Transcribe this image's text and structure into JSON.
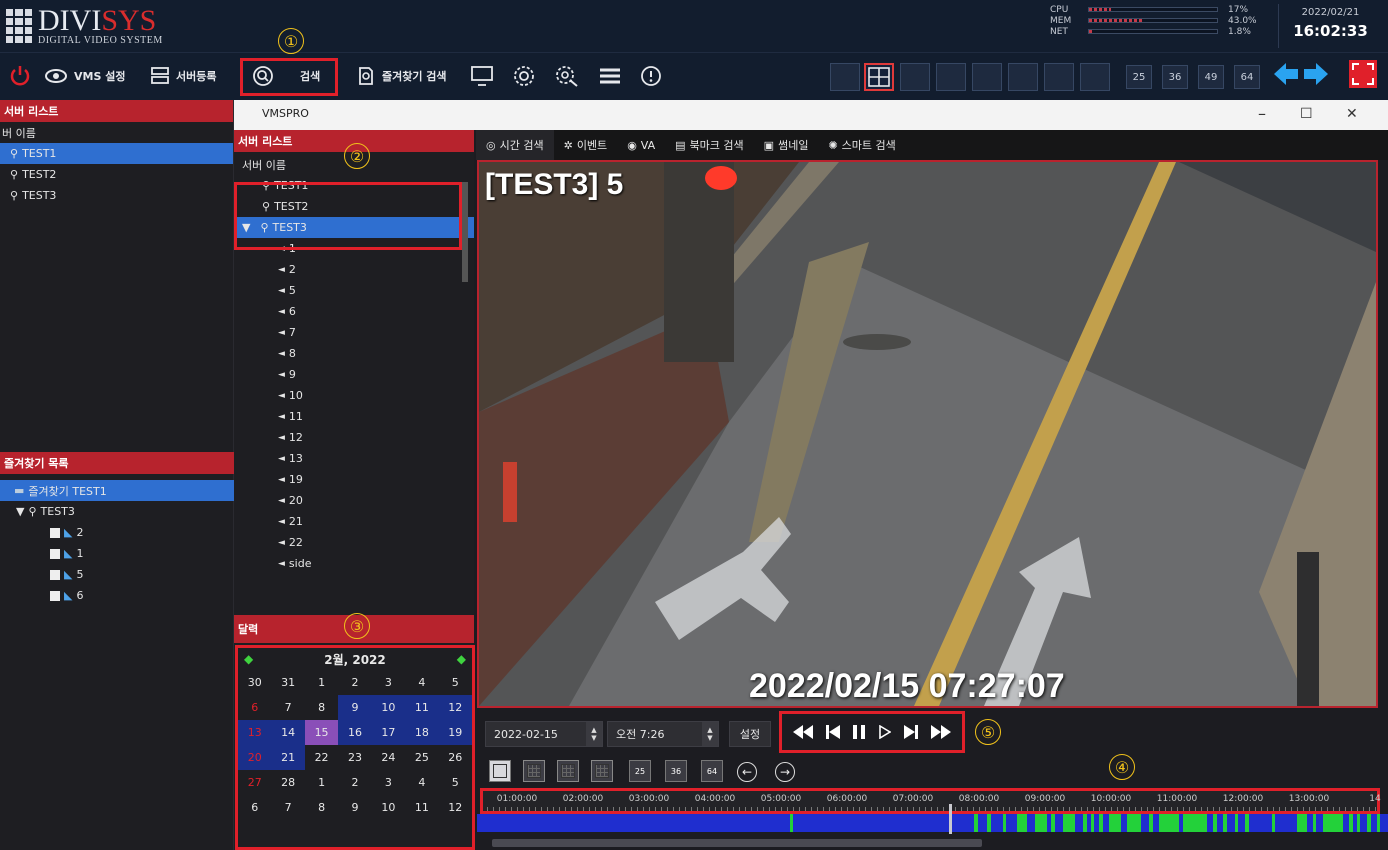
{
  "header": {
    "brand": "DIVISYS",
    "brand_sub": "DIGITAL VIDEO SYSTEM",
    "monitor": [
      {
        "label": "CPU",
        "value": "17%",
        "level": 0.17
      },
      {
        "label": "MEM",
        "value": "43.0%",
        "level": 0.43
      },
      {
        "label": "NET",
        "value": "1.8%",
        "level": 0.02
      }
    ],
    "date": "2022/02/21",
    "time": "16:02:33"
  },
  "toolbar": {
    "vms_settings": "VMS 설정",
    "server_register": "서버등록",
    "search": "검색",
    "bookmark_search": "즐겨찾기 검색",
    "layout_numbers": [
      "25",
      "36",
      "49",
      "64"
    ]
  },
  "callouts": [
    "①",
    "②",
    "③",
    "④",
    "⑤"
  ],
  "left_panel": {
    "server_list_title": "서버 리스트",
    "server_name_header": "버 이름",
    "servers": [
      "TEST1",
      "TEST2",
      "TEST3"
    ],
    "favorites_title": "즐겨찾기 목록",
    "favorite_group": "즐겨찾기 TEST1",
    "favorite_server": "TEST3",
    "favorite_cameras": [
      "2",
      "1",
      "5",
      "6"
    ]
  },
  "window": {
    "title": "VMSPRO",
    "minimize": "–",
    "maximize": "☐",
    "close": "✕"
  },
  "mid_panel": {
    "server_list_title": "서버 리스트",
    "server_name_header": "서버 이름",
    "servers": [
      "TEST1",
      "TEST2",
      "TEST3"
    ],
    "channels": [
      "1",
      "2",
      "5",
      "6",
      "7",
      "8",
      "9",
      "10",
      "11",
      "12",
      "13",
      "19",
      "20",
      "21",
      "22",
      "side"
    ],
    "calendar_title": "달력"
  },
  "calendar": {
    "month_label": "2월, 2022",
    "rows": [
      [
        "30",
        "31",
        "1",
        "2",
        "3",
        "4",
        "5"
      ],
      [
        "6",
        "7",
        "8",
        "9",
        "10",
        "11",
        "12"
      ],
      [
        "13",
        "14",
        "15",
        "16",
        "17",
        "18",
        "19"
      ],
      [
        "20",
        "21",
        "22",
        "23",
        "24",
        "25",
        "26"
      ],
      [
        "27",
        "28",
        "1",
        "2",
        "3",
        "4",
        "5"
      ],
      [
        "6",
        "7",
        "8",
        "9",
        "10",
        "11",
        "12"
      ]
    ]
  },
  "tabs": [
    "시간 검색",
    "이벤트",
    "VA",
    "북마크 검색",
    "썸네일",
    "스마트 검색"
  ],
  "video": {
    "camera_label": "[TEST3] 5",
    "timestamp": "2022/02/15 07:27:07"
  },
  "controls": {
    "date": "2022-02-15",
    "time": "오전 7:26",
    "set_label": "설정"
  },
  "timeline": {
    "hours": [
      "01:00:00",
      "02:00:00",
      "03:00:00",
      "04:00:00",
      "05:00:00",
      "06:00:00",
      "07:00:00",
      "08:00:00",
      "09:00:00",
      "10:00:00",
      "11:00:00",
      "12:00:00",
      "13:00:00",
      "14"
    ]
  },
  "colors": {
    "accent_red": "#b7232d",
    "highlight_red": "#e0202a",
    "selection_blue": "#2f6fd0",
    "callout_yellow": "#f1c21b",
    "recording_blue": "#1f2ecf",
    "event_green": "#23d13a"
  }
}
